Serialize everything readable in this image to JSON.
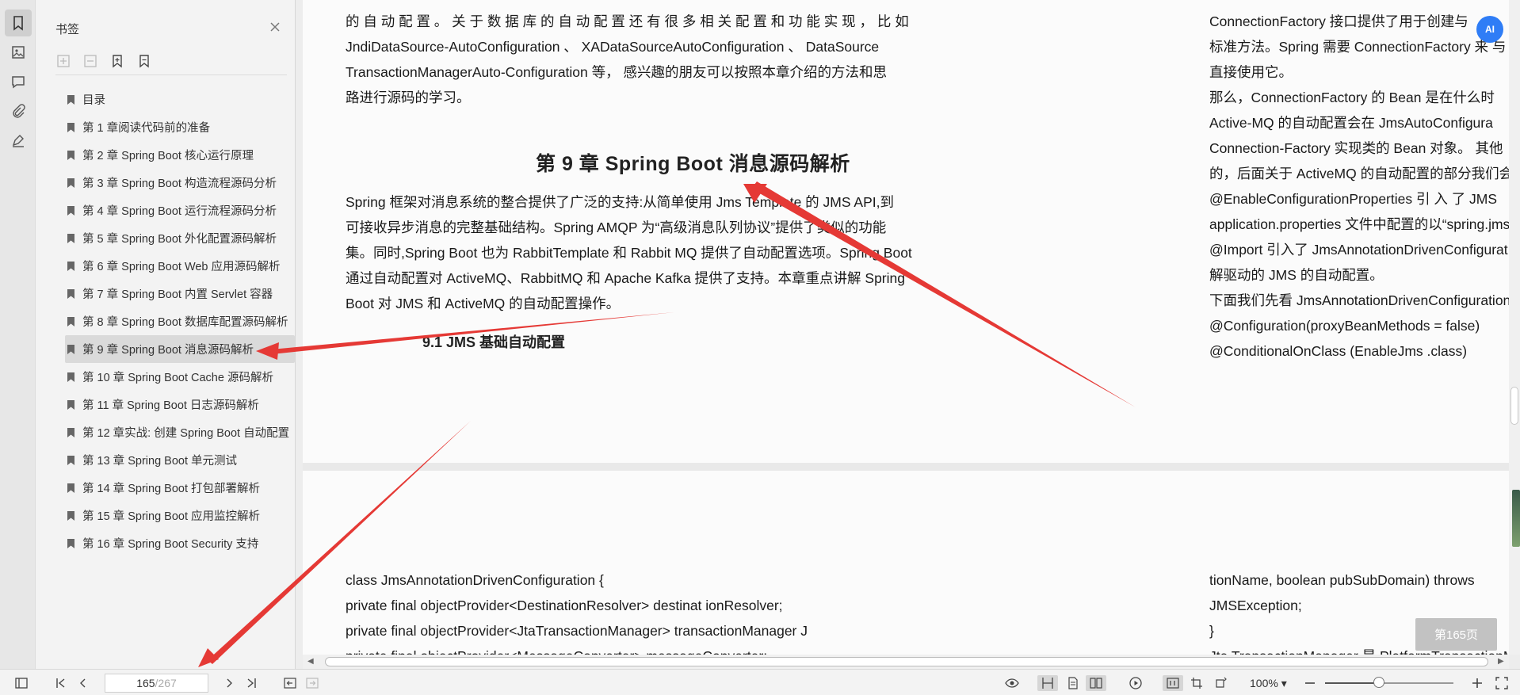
{
  "panel": {
    "title": "书签",
    "items": [
      {
        "label": "目录"
      },
      {
        "label": "第 1 章阅读代码前的准备"
      },
      {
        "label": "第 2 章 Spring Boot 核心运行原理"
      },
      {
        "label": "第 3 章 Spring Boot 构造流程源码分析"
      },
      {
        "label": "第 4 章 Spring Boot 运行流程源码分析"
      },
      {
        "label": "第 5 章 Spring Boot 外化配置源码解析"
      },
      {
        "label": "第 6 章 Spring Boot Web 应用源码解析"
      },
      {
        "label": "第 7 章 Spring Boot 内置 Servlet 容器"
      },
      {
        "label": "第 8 章 Spring Boot 数据库配置源码解析"
      },
      {
        "label": "第 9 章 Spring Boot 消息源码解析"
      },
      {
        "label": "第 10 章 Spring Boot Cache 源码解析"
      },
      {
        "label": "第 11 章 Spring Boot 日志源码解析"
      },
      {
        "label": "第 12 章实战: 创建 Spring Boot 自动配置"
      },
      {
        "label": "第 13 章 Spring Boot 单元测试"
      },
      {
        "label": "第 14 章 Spring Boot 打包部署解析"
      },
      {
        "label": "第 15 章 Spring Boot 应用监控解析"
      },
      {
        "label": "第 16 章 Spring Boot Security 支持"
      }
    ],
    "selected_index": 9
  },
  "page1": {
    "top_lines": [
      "的 自 动 配 置 。 关 于 数 据 库 的 自 动 配 置 还 有 很 多 相 关 配 置 和 功 能 实 现 ， 比 如",
      "JndiDataSource-AutoConfiguration 、 XADataSourceAutoConfiguration 、 DataSource",
      "TransactionManagerAuto-Configuration 等， 感兴趣的朋友可以按照本章介绍的方法和思",
      "路进行源码的学习。"
    ],
    "chapter_heading": "第 9 章 Spring Boot 消息源码解析",
    "intro_lines": [
      "Spring 框架对消息系统的整合提供了广泛的支持:从简单使用 Jms Template 的 JMS API,到",
      "可接收异步消息的完整基础结构。Spring AMQP 为“高级消息队列协议”提供了类似的功能",
      "集。同时,Spring Boot 也为 RabbitTemplate 和 Rabbit MQ 提供了自动配置选项。Spring Boot",
      "通过自动配置对 ActiveMQ、RabbitMQ 和 Apache Kafka 提供了支持。本章重点讲解 Spring",
      "Boot 对 JMS 和 ActiveMQ 的自动配置操作。"
    ],
    "section_heading": "9.1 JMS 基础自动配置",
    "right_lines": [
      "ConnectionFactory 接口提供了用于创建与",
      "标准方法。Spring 需要 ConnectionFactory 来 与",
      "直接使用它。",
      "那么，ConnectionFactory 的 Bean 是在什么时",
      "Active-MQ 的自动配置会在 JmsAutoConfigura",
      "Connection-Factory 实现类的 Bean 对象。 其他",
      "的，后面关于 ActiveMQ 的自动配置的部分我们会",
      "@EnableConfigurationProperties 引 入 了 JMS",
      "application.properties 文件中配置的以“spring.jms",
      "@Import 引入了 JmsAnnotationDrivenConfigurat",
      "解驱动的 JMS 的自动配置。",
      "下面我们先看 JmsAnnotationDrivenConfiguration",
      "@Configuration(proxyBeanMethods = false)",
      "@ConditionalOnClass (EnableJms .class)"
    ]
  },
  "page2": {
    "left_lines": [
      "class JmsAnnotationDrivenConfiguration {",
      "private final objectProvider<DestinationResolver> destinat ionResolver;",
      "private final objectProvider<JtaTransactionManager> transactionManager J",
      "private final objectProvider<MessageConverter> messageConverter;"
    ],
    "right_lines": [
      "tionName, boolean pubSubDomain) throws",
      "JMSException;",
      "}",
      "Jta TransactionManager 是 PlatformTransactionM"
    ]
  },
  "page_badge": "第165页",
  "ai_badge": "AI",
  "status": {
    "current_page": "165",
    "total_pages": "/267",
    "zoom": "100%",
    "zoom_fraction": 0.42
  },
  "colors": {
    "accent": "#2f7df6",
    "annotation_arrow": "#e53935"
  }
}
